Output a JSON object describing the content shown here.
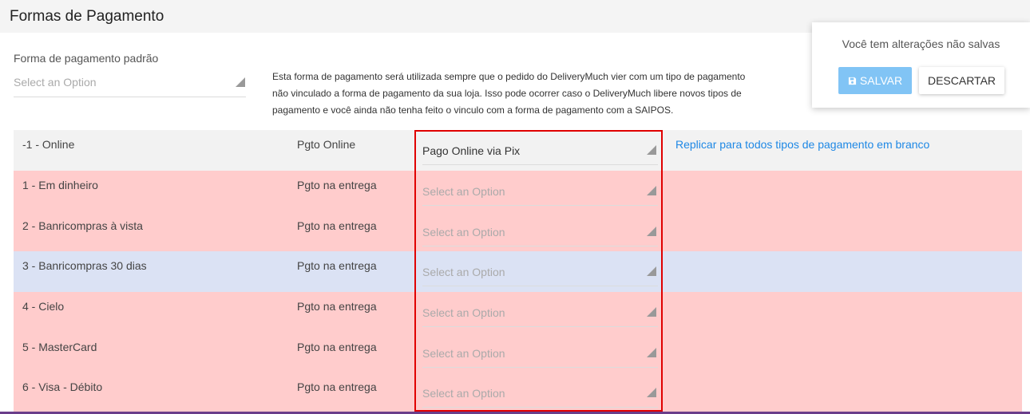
{
  "page": {
    "title": "Formas de Pagamento"
  },
  "default_payment": {
    "label": "Forma de pagamento padrão",
    "placeholder": "Select an Option",
    "help_text": "Esta forma de pagamento será utilizada sempre que o pedido do DeliveryMuch vier com um tipo de pagamento não vinculado a forma de pagamento da sua loja. Isso pode ocorrer caso o DeliveryMuch libere novos tipos de pagamento e você ainda não tenha feito o vinculo com a forma de pagamento com a SAIPOS."
  },
  "table": {
    "replicate_link": "Replicar para todos tipos de pagamento em branco",
    "rows": [
      {
        "name": "-1 - Online",
        "type": "Pgto Online",
        "selected": "Pago Online via Pix"
      },
      {
        "name": "1 - Em dinheiro",
        "type": "Pgto na entrega",
        "selected": "Select an Option"
      },
      {
        "name": "2 - Banricompras à vista",
        "type": "Pgto na entrega",
        "selected": "Select an Option"
      },
      {
        "name": "3 - Banricompras 30 dias",
        "type": "Pgto na entrega",
        "selected": "Select an Option"
      },
      {
        "name": "4 - Cielo",
        "type": "Pgto na entrega",
        "selected": "Select an Option"
      },
      {
        "name": "5 - MasterCard",
        "type": "Pgto na entrega",
        "selected": "Select an Option"
      },
      {
        "name": "6 - Visa - Débito",
        "type": "Pgto na entrega",
        "selected": "Select an Option"
      }
    ]
  },
  "unsaved": {
    "message": "Você tem alterações não salvas",
    "save_label": "SALVAR",
    "discard_label": "DESCARTAR"
  },
  "colors": {
    "row_unmapped": "#ffcccc",
    "row_hover": "#dbe2f4",
    "link": "#1e88e5",
    "save_button": "#81c4f5",
    "highlight": "#e00000"
  },
  "icons": {
    "save": "floppy-disk-icon",
    "select_caret": "caret-corner-icon"
  }
}
